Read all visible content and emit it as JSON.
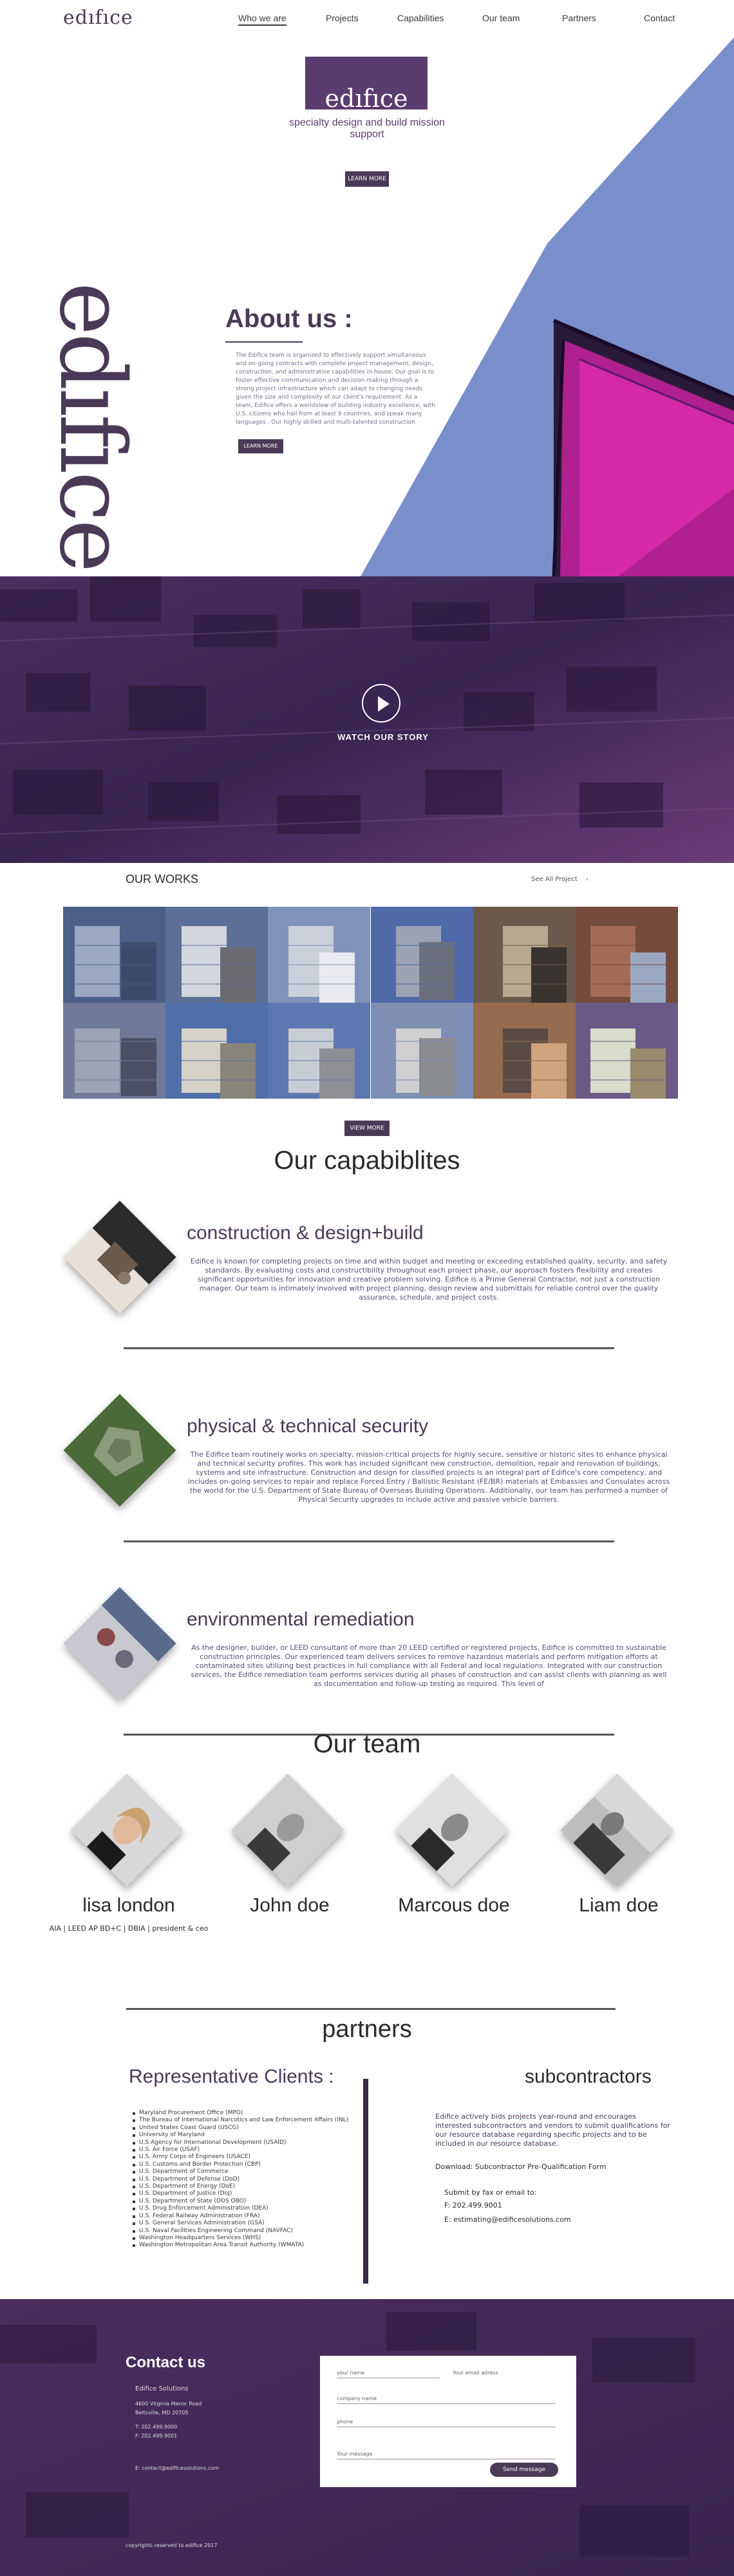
{
  "nav": {
    "logo": "edıfıce",
    "items": [
      {
        "label": "Who we are",
        "active": true
      },
      {
        "label": "Projects",
        "active": false
      },
      {
        "label": "Capabilities",
        "active": false
      },
      {
        "label": "Our team",
        "active": false
      },
      {
        "label": "Partners",
        "active": false
      },
      {
        "label": "Contact",
        "active": false
      }
    ]
  },
  "hero": {
    "logo_text": "edıfıce",
    "tagline": "specialty design and build mission support",
    "button_label": "LEARN MORE",
    "vertical_word": "edıfıce",
    "colors": {
      "accent": "#5a3d6e",
      "dark": "#4a3a58",
      "sky": "#7a8ecb",
      "magenta": "#b0208e"
    }
  },
  "about": {
    "title": "About us :",
    "text": "The Edifice team is organized to effectively support simultaneous and on-going contracts with complete project management, design, construction, and administrative capabilities in-house. Our goal is to foster effective communication and decision making through a strong project infrastructure which can adapt to changing needs given the size and complexity of our client's requirement. As a team, Edifice offers a worldview of building industry excellence, with U.S. citizens who hail from at least 9 countries, and speak many languages . Our highly skilled and multi-talented construction",
    "button_label": "LEARN MORE"
  },
  "video": {
    "label": "WATCH OUR STORY"
  },
  "works": {
    "title": "OUR WORKS",
    "see_all": "See All Project",
    "more_button": "VIEW MORE",
    "tiles": [
      {
        "palette": [
          "#4a5f8a",
          "#9aa8c4",
          "#3c4b6e"
        ]
      },
      {
        "palette": [
          "#5a6f9a",
          "#d2d6de",
          "#6b6a72"
        ]
      },
      {
        "palette": [
          "#7f92bf",
          "#c9cfdb",
          "#e8eaf0"
        ]
      },
      {
        "palette": [
          "#4c69b0",
          "#9aa2b6",
          "#6c7080"
        ]
      },
      {
        "palette": [
          "#6d5a4a",
          "#b8a98c",
          "#3a3430"
        ]
      },
      {
        "palette": [
          "#7a4a3a",
          "#a86a52",
          "#9aa8c4"
        ]
      },
      {
        "palette": [
          "#6d7a9a",
          "#9ca4b8",
          "#4a5068"
        ]
      },
      {
        "palette": [
          "#4d6fb0",
          "#d6d2c8",
          "#8a8478"
        ]
      },
      {
        "palette": [
          "#5a77b8",
          "#c8ccd4",
          "#8e8f96"
        ]
      },
      {
        "palette": [
          "#7d8fb8",
          "#cfcfd0",
          "#8b8c90"
        ]
      },
      {
        "palette": [
          "#9a6a4a",
          "#5a4a44",
          "#d2a278"
        ]
      },
      {
        "palette": [
          "#6a5a8a",
          "#d8dcc8",
          "#9a8a6a"
        ]
      }
    ]
  },
  "capabilities": {
    "title": "Our capabiblites",
    "items": [
      {
        "heading": "construction & design+build",
        "text": "Edifice is known for completing projects on time and within budget and meeting or exceeding established quality, security, and safety standards. By evaluating costs and constructibility throughout each project phase, our approach fosters flexibility and creates significant opportunities for innovation and creative problem solving. Edifice is a Prime General Contractor, not just a construction manager. Our team is intimately involved with project planning, design review and submittals for reliable control over the quality assurance, schedule, and project costs.",
        "palette": [
          "#2a2a2a",
          "#6a5a4a",
          "#e6e0d8"
        ]
      },
      {
        "heading": "physical & technical security",
        "text": "The Edifice team routinely works on specialty, mission-critical projects for highly secure, sensitive or historic sites to enhance physical and technical security profiles. This work has included significant new construction, demolition, repair and renovation of buildings, systems and site infrastructure. Construction and design for classified projects is an integral part of Edifice's core competency, and includes on-going services to repair and replace Forced Entry / Ballistic Resistant (FE/BR) materials at Embassies and Consulates across the world for the U.S. Department of State Bureau of Overseas Building Operations. Additionally, our team has performed a number of Physical Security upgrades to include active and passive vehicle barriers.",
        "palette": [
          "#4a6a3a",
          "#8a9a7a",
          "#6a7a5a"
        ]
      },
      {
        "heading": "environmental remediation",
        "text": "As the designer, builder, or LEED consultant of more than 20 LEED certified or registered projects, Edifice is committed to sustainable construction principles. Our experienced team delivers services to remove hazardous materials and perform mitigation efforts at contaminated sites utilizing best practices in full compliance with all Federal and local regulations. Integrated with our construction services, the Edifice remediation team performs services during all phases of construction and can assist clients with planning as well as documentation and follow-up testing as required. This level of",
        "palette": [
          "#5a6a8a",
          "#c8c8d0",
          "#8a4a4a"
        ]
      }
    ]
  },
  "team": {
    "title": "Our team",
    "members": [
      {
        "name": "lisa london",
        "role": "AIA | LEED AP BD+C | DBIA | president & ceo",
        "tone": "#b08a74"
      },
      {
        "name": "John doe",
        "role": "",
        "tone": "#8a8a8a"
      },
      {
        "name": "Marcous doe",
        "role": "",
        "tone": "#6a6a6a"
      },
      {
        "name": "Liam doe",
        "role": "",
        "tone": "#7a7a7a"
      }
    ]
  },
  "partners": {
    "title": "partners",
    "rep_title": "Representative Clients :",
    "clients": [
      "Maryland Procurement Office (MPO)",
      "The Bureau of International Narcotics and Law Enforcement Affairs (INL)",
      "United States Coast Guard (USCG)",
      "University of Maryland",
      "U.S Agency for International Development (USAID)",
      "U.S. Air Force (USAF)",
      "U.S. Army Corps of Engineers (USACE)",
      "U.S. Customs and Border Protection (CBP)",
      "U.S. Department of Commerce",
      "U.S. Department of Defense (DoD)",
      "U.S. Department of Energy (DoE)",
      "U.S. Department of Justice (DoJ)",
      "U.S. Department of State (DOS OBO)",
      "U.S. Drug Enforcement Administration (DEA)",
      "U.S. Federal Railway Administration (FRA)",
      "U.S. General Services Administration (GSA)",
      "U.S. Naval Facilities Engineering Command (NAVFAC)",
      "Washington Headquarters Services (WHS)",
      "Washington Metropolitan Area Transit Authority (WMATA)"
    ],
    "sub_title": "subcontractors",
    "sub_text": "Edifice actively bids projects year-round and encourages interested subcontractors and vendors to submit qualifications for our resource database regarding specific projects and to be included in our resource database.",
    "download": "Download: Subcontractor Pre-Qualification Form",
    "submit_label": "Submit by fax or email to:",
    "fax": "F: 202.499.9001",
    "email": "E: estimating@edificesolutions.com"
  },
  "footer": {
    "contact_title": "Contact us",
    "company": "Edifice Solutions",
    "address_lines": [
      "4600 Virginia Manor Road",
      "Beltsville, MD 20705",
      "T: 202.499.9000",
      "F: 202.499.9001"
    ],
    "email": "E: contact@edificesolutions.com",
    "copyright": "copyrights reserved to edifice 2017",
    "form": {
      "name": "your name",
      "email": "Your email adress",
      "company": "company name",
      "phone": "phone",
      "message": "Your message",
      "send": "Send message"
    }
  }
}
